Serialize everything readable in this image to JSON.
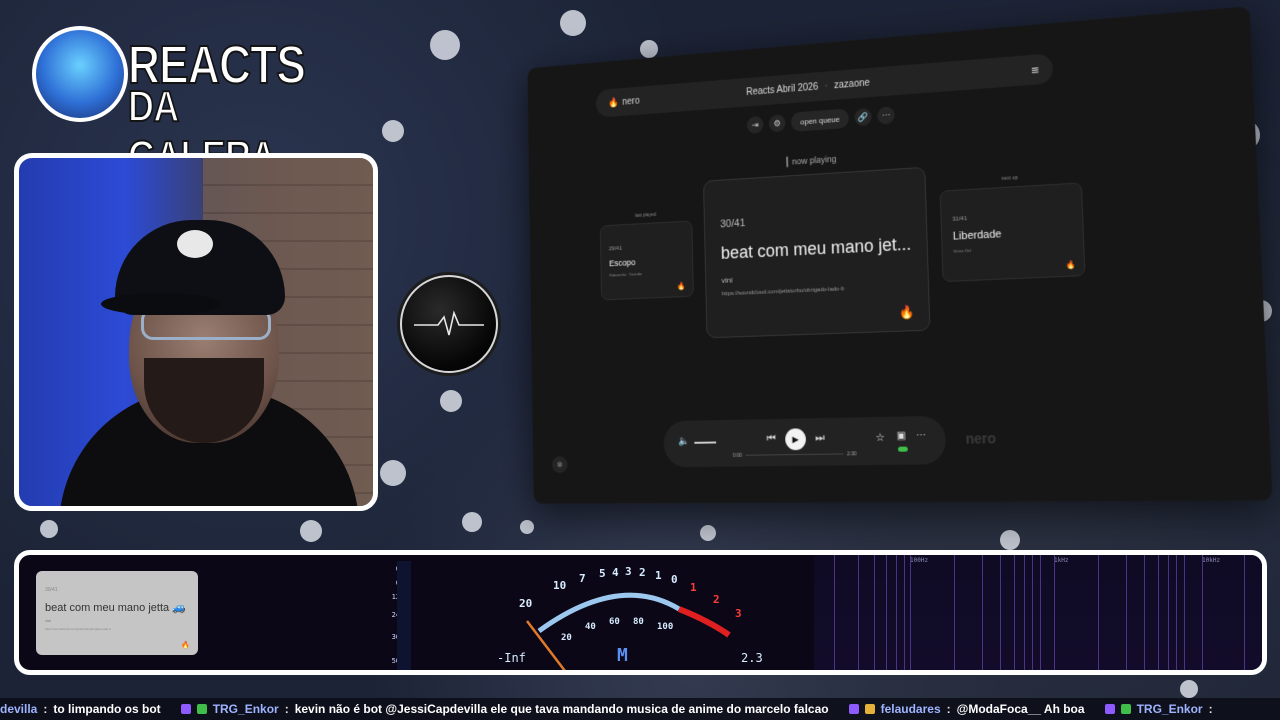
{
  "logo": {
    "line1": "REACTS",
    "line2": "DA GALERA"
  },
  "app": {
    "brand": "nero",
    "playlist_title": "Reacts Abril 2026",
    "owner": "zazaone",
    "actions": {
      "open_queue": "open queue"
    },
    "now_playing_label": "now playing",
    "last_played": {
      "label": "last played",
      "number": "29/41",
      "title": "Escopo",
      "artist": "Robozinho",
      "source": "Youtube"
    },
    "current": {
      "number": "30/41",
      "title": "beat com meu mano jet...",
      "artist": "vini",
      "link": "https://soundcloud.com/jettsturbo/obrigado-lado-b"
    },
    "next_up": {
      "label": "next up",
      "number": "31/41",
      "title": "Liberdade",
      "artist": "Victor Ziel"
    },
    "player": {
      "time_current": "0:00",
      "time_total": "2:30"
    },
    "watermark": "nero"
  },
  "mini_card": {
    "number": "30/41",
    "title": "beat com meu mano jetta 🚙",
    "artist": "vini",
    "link": "https://soundcloud.com/jettsturbo/obrigado-lado-b"
  },
  "meter": {
    "scale_ticks": [
      "0",
      "6",
      "12",
      "24",
      "36",
      "50"
    ],
    "vu_labels": [
      "20",
      "10",
      "7",
      "5",
      "4",
      "3",
      "2",
      "1",
      "0"
    ],
    "vu_red_labels": [
      "1",
      "2",
      "3"
    ],
    "vu_sub_labels": [
      "20",
      "40",
      "60",
      "80",
      "100"
    ],
    "min_label": "-Inf",
    "mode": "M",
    "value": "2.3",
    "spectrum_labels": [
      "100Hz",
      "1kHz",
      "10kHz"
    ]
  },
  "chat": [
    {
      "user": "devilla",
      "message": "to limpando os bot"
    },
    {
      "user": "TRG_Enkor",
      "message": "kevin não é bot @JessiCapdevilla  ele que tava mandando musica de anime do marcelo falcao"
    },
    {
      "user": "felaudares",
      "message": "@ModaFoca__ Ah boa"
    },
    {
      "user": "TRG_Enkor",
      "message": ""
    }
  ]
}
